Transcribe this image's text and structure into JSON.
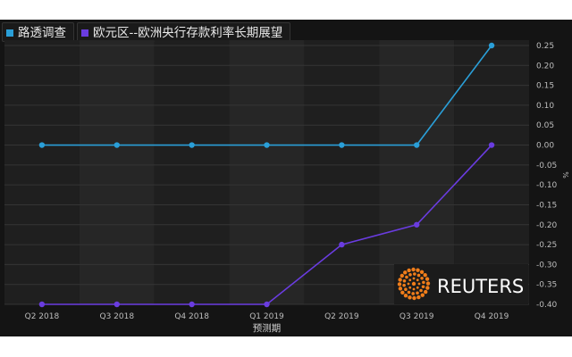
{
  "chart_data": {
    "type": "line",
    "categories": [
      "Q2 2018",
      "Q3 2018",
      "Q4 2018",
      "Q1 2019",
      "Q2 2019",
      "Q3 2019",
      "Q4 2019"
    ],
    "series": [
      {
        "name": "路透调查",
        "color": "#2a9fd8",
        "values": [
          0.0,
          0.0,
          0.0,
          0.0,
          0.0,
          0.0,
          0.25
        ]
      },
      {
        "name": "欧元区--欧洲央行存款利率长期展望",
        "color": "#6a3ce0",
        "values": [
          -0.4,
          -0.4,
          -0.4,
          -0.4,
          -0.25,
          -0.2,
          0.0
        ]
      }
    ],
    "xlabel": "预测期",
    "ylabel": "%",
    "ylim": [
      -0.4,
      0.25
    ],
    "yticks": [
      0.25,
      0.2,
      0.15,
      0.1,
      0.05,
      0.0,
      -0.05,
      -0.1,
      -0.15,
      -0.2,
      -0.25,
      -0.3,
      -0.35,
      -0.4
    ],
    "ytick_labels": [
      "0.25",
      "0.20",
      "0.15",
      "0.10",
      "0.05",
      "0.00",
      "-0.05",
      "-0.10",
      "-0.15",
      "-0.20",
      "-0.25",
      "-0.30",
      "-0.35",
      "-0.40"
    ],
    "grid": true,
    "legend": "top-left"
  },
  "logo": {
    "text": "REUTERS"
  }
}
